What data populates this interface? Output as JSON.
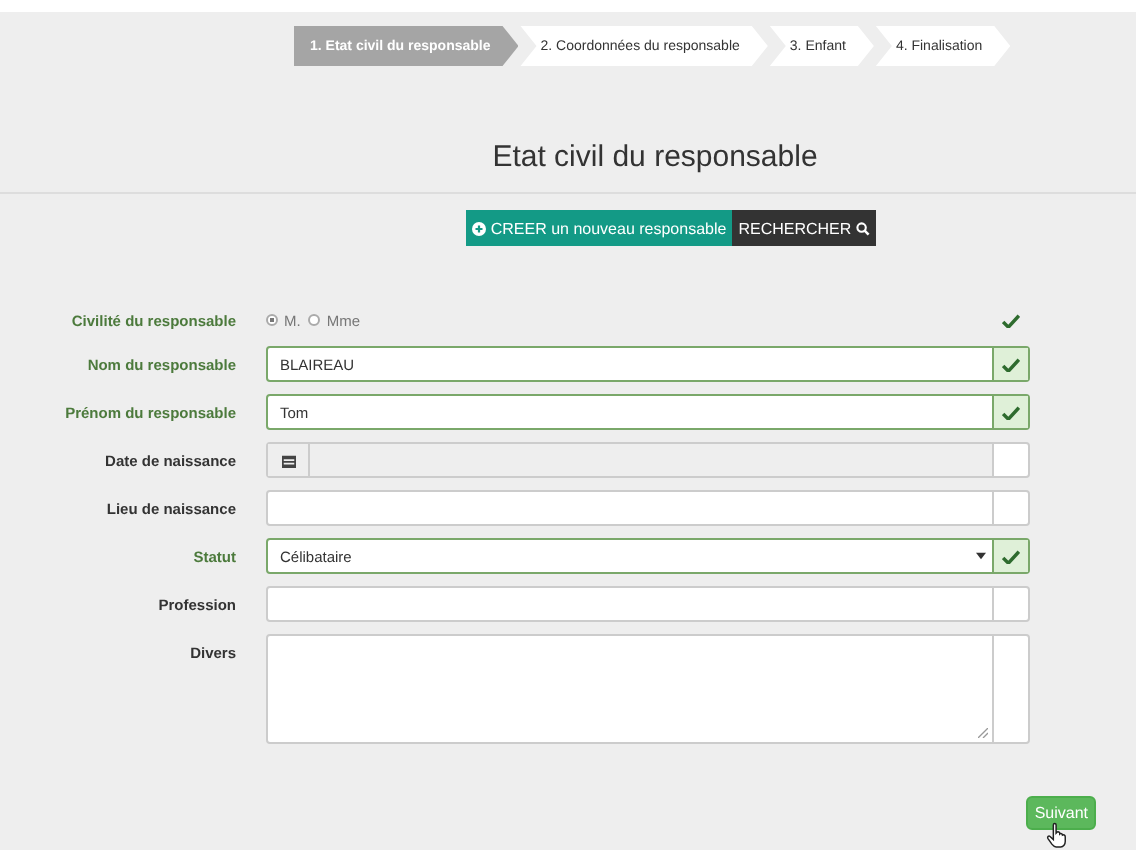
{
  "steps": [
    {
      "label": "1. Etat civil du responsable",
      "selected": true
    },
    {
      "label": "2. Coordonnées du responsable",
      "selected": false
    },
    {
      "label": "3. Enfant",
      "selected": false
    },
    {
      "label": "4. Finalisation",
      "selected": false
    }
  ],
  "heading": "Etat civil du responsable",
  "actions": {
    "create": "CREER un nouveau responsable",
    "search": "RECHERCHER"
  },
  "fields": [
    {
      "kind": "radio",
      "label": "Civilité du responsable",
      "valid": true,
      "options": [
        {
          "label": "M.",
          "selected": true
        },
        {
          "label": "Mme",
          "selected": false
        }
      ]
    },
    {
      "kind": "text",
      "label": "Nom du responsable",
      "value": "BLAIREAU",
      "valid": true
    },
    {
      "kind": "text",
      "label": "Prénom du responsable",
      "value": "Tom",
      "valid": true
    },
    {
      "kind": "date",
      "label": "Date de naissance",
      "valid": false,
      "disabled": true
    },
    {
      "kind": "text",
      "label": "Lieu de naissance",
      "valid": false
    },
    {
      "kind": "select",
      "label": "Statut",
      "value": "Célibataire",
      "valid": true
    },
    {
      "kind": "text",
      "label": "Profession",
      "valid": false
    },
    {
      "kind": "textarea",
      "label": "Divers",
      "valid": false
    }
  ],
  "next_button": "Suivant"
}
